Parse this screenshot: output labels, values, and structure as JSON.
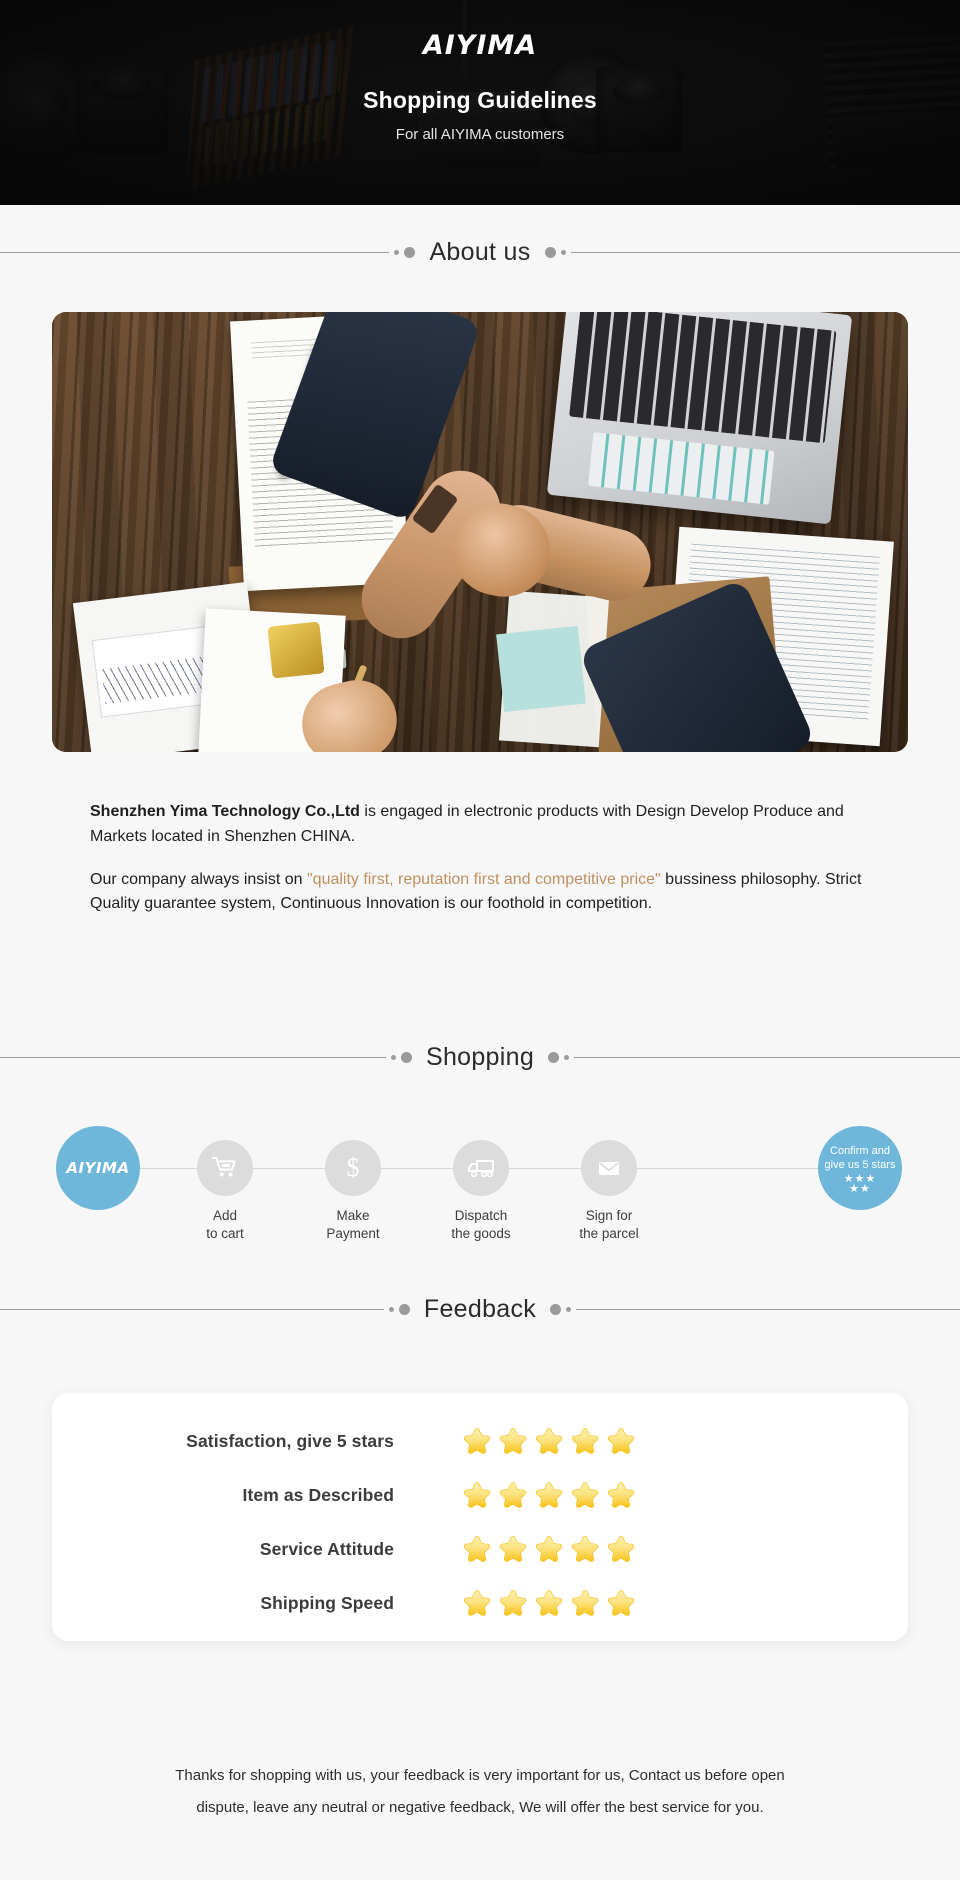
{
  "banner": {
    "brand": "AIYIMA",
    "title": "Shopping Guidelines",
    "subtitle": "For all AIYIMA customers"
  },
  "sections": {
    "about_title": "About us",
    "shopping_title": "Shopping",
    "feedback_title": "Feedback"
  },
  "about": {
    "photo_alt": "business-handshake-photo",
    "paragraph1_strong": "Shenzhen Yima Technology Co.,Ltd",
    "paragraph1_rest": " is engaged in electronic products with Design Develop Produce and Markets located in Shenzhen CHINA.",
    "paragraph2_lead": "Our company always insist on ",
    "paragraph2_quote": "\"quality first, reputation first and competitive price\"",
    "paragraph2_rest": " bussiness philosophy. Strict Quality guarantee system, Continuous Innovation is our foothold in competition."
  },
  "shopping": {
    "brand_label": "AIYIMA",
    "steps": [
      {
        "icon": "cart-icon",
        "line1": "Add",
        "line2": "to cart"
      },
      {
        "icon": "dollar-icon",
        "line1": "Make",
        "line2": "Payment"
      },
      {
        "icon": "truck-icon",
        "line1": "Dispatch",
        "line2": "the goods"
      },
      {
        "icon": "envelope-icon",
        "line1": "Sign for",
        "line2": "the parcel"
      }
    ],
    "final": {
      "line1": "Confirm and",
      "line2": "give us 5 stars",
      "stars_row1": "★★★",
      "stars_row2": "★★"
    },
    "accent_color": "#6fb7da",
    "circle_color": "#dcdcdc"
  },
  "feedback": {
    "rows": [
      {
        "label": "Satisfaction, give 5 stars",
        "stars": 5
      },
      {
        "label": "Item as Described",
        "stars": 5
      },
      {
        "label": "Service Attitude",
        "stars": 5
      },
      {
        "label": "Shipping Speed",
        "stars": 5
      }
    ],
    "star_color": "#fcd94b"
  },
  "footer": {
    "line1": "Thanks for shopping with us, your feedback is very important for us, Contact us before open",
    "line2": "dispute, leave any neutral or negative feedback, We will offer the best service for you."
  }
}
